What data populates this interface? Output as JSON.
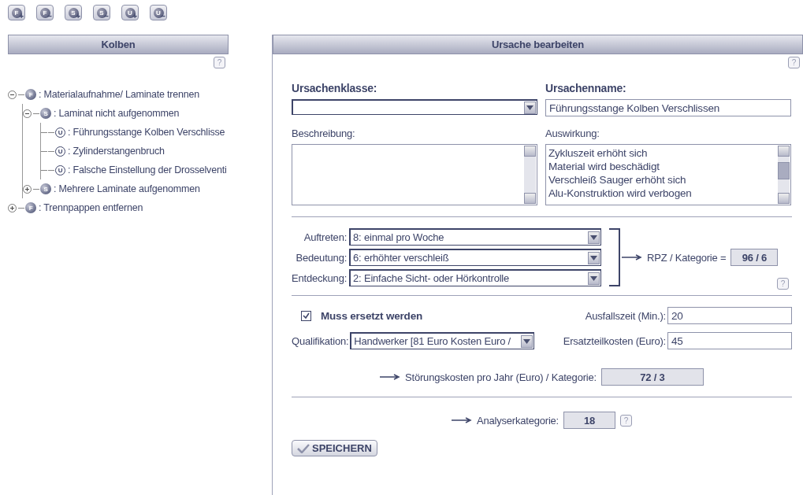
{
  "toolbar": [
    {
      "letter": "F",
      "sign": "+"
    },
    {
      "letter": "F",
      "sign": "−"
    },
    {
      "letter": "S",
      "sign": "+"
    },
    {
      "letter": "S",
      "sign": "−"
    },
    {
      "letter": "U",
      "sign": "+"
    },
    {
      "letter": "U",
      "sign": "−"
    }
  ],
  "tree_panel": {
    "title": "Kolben",
    "help": "?",
    "nodes": [
      {
        "badge": "F",
        "label": ": Materialaufnahme/ Laminate trennen",
        "expanded": true,
        "children": [
          {
            "badge": "S",
            "label": ": Laminat nicht aufgenommen",
            "expanded": true,
            "children": [
              {
                "badge": "U",
                "label": ": Führungsstange Kolben Verschlisse"
              },
              {
                "badge": "U",
                "label": ": Zylinderstangenbruch"
              },
              {
                "badge": "U",
                "label": ": Falsche Einstellung der Drosselventi"
              }
            ]
          },
          {
            "badge": "S",
            "label": ": Mehrere Laminate aufgenommen",
            "expanded": false
          }
        ]
      },
      {
        "badge": "F",
        "label": ": Trennpappen entfernen",
        "expanded": false
      }
    ]
  },
  "editor": {
    "title": "Ursache bearbeiten",
    "help": "?",
    "ursachenklasse": {
      "label": "Ursachenklasse:"
    },
    "ursachenname": {
      "label": "Ursachenname:",
      "value": "Führungsstange Kolben Verschlissen"
    },
    "beschreibung": {
      "label": "Beschreibung:"
    },
    "auswirkung": {
      "label": "Auswirkung:",
      "lines": [
        "Zykluszeit erhöht sich",
        "Material wird beschädigt",
        "Verschleiß Sauger erhöht sich",
        "Alu-Konstruktion wird verbogen"
      ]
    },
    "ratings": [
      {
        "label": "Auftreten:",
        "value": "8: einmal pro Woche"
      },
      {
        "label": "Bedeutung:",
        "value": "6: erhöhter verschleiß"
      },
      {
        "label": "Entdeckung:",
        "value": "2: Einfache Sicht- oder Hörkontrolle"
      }
    ],
    "rpz": {
      "label": "RPZ / Kategorie =",
      "value": "96 / 6",
      "help": "?"
    },
    "muss_ersetzt": {
      "label": "Muss ersetzt werden",
      "checked": true
    },
    "qualifikation": {
      "label": "Qualifikation:",
      "value": "Handwerker [81 Euro Kosten Euro /"
    },
    "ausfallszeit": {
      "label": "Ausfallszeit (Min.):",
      "value": "20"
    },
    "ersatzteilkosten": {
      "label": "Ersatzteilkosten (Euro):",
      "value": "45"
    },
    "stoerungskosten": {
      "label": "Störungskosten pro Jahr (Euro) / Kategorie:",
      "value": "72 / 3"
    },
    "analyserkategorie": {
      "label": "Analyserkategorie:",
      "value": "18",
      "help": "?"
    },
    "save": "SPEICHERN"
  }
}
